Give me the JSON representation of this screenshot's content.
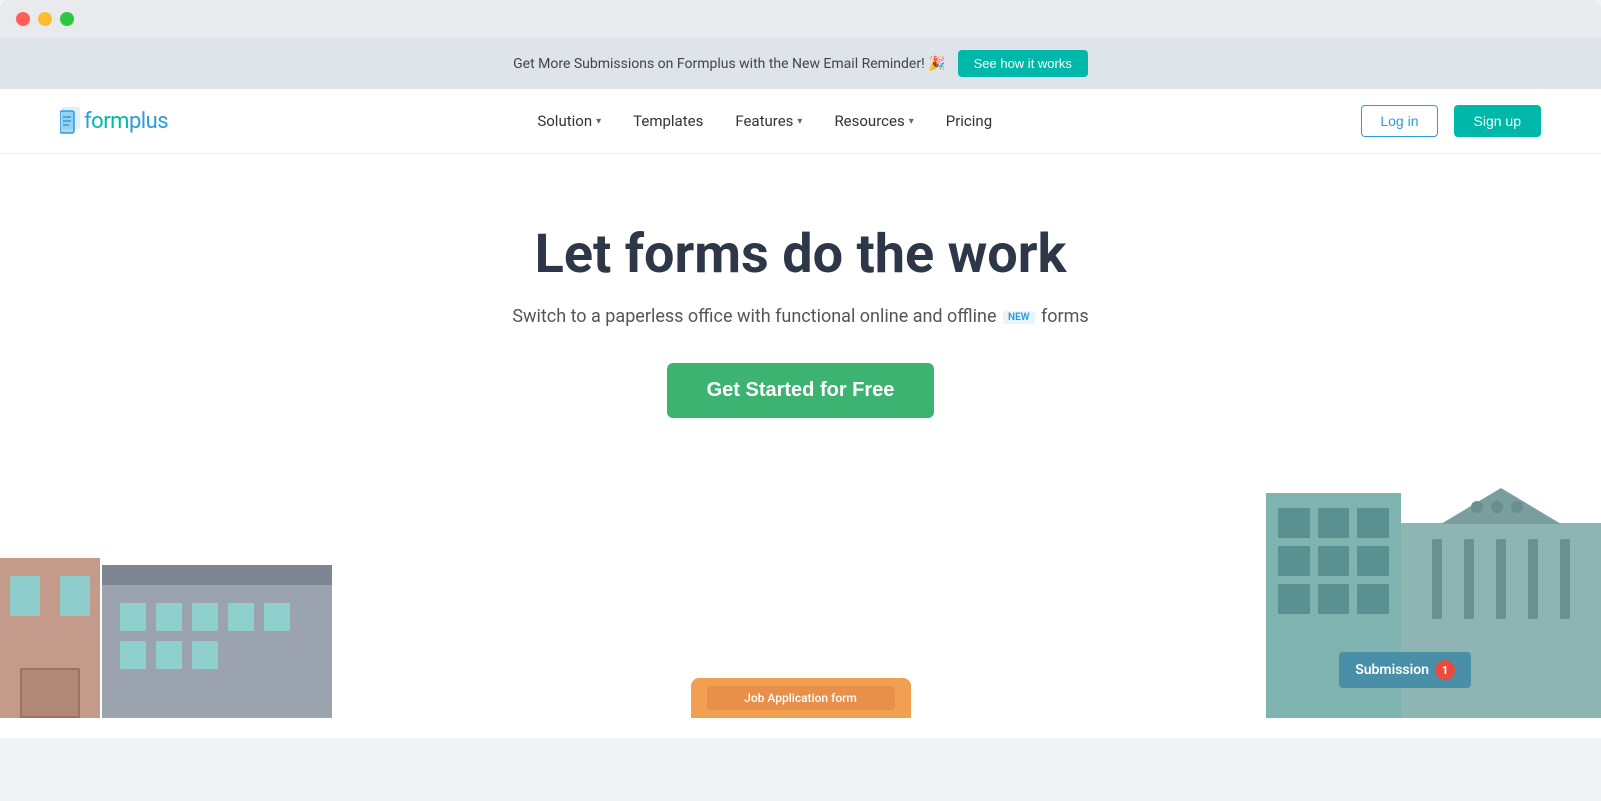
{
  "browser": {
    "dots": [
      "red",
      "yellow",
      "green"
    ]
  },
  "announcement": {
    "text": "Get More Submissions on Formplus with the New Email Reminder! 🎉",
    "cta": "See how it works"
  },
  "nav": {
    "logo_text": "formplus",
    "links": [
      {
        "label": "Solution",
        "has_dropdown": true
      },
      {
        "label": "Templates",
        "has_dropdown": false
      },
      {
        "label": "Features",
        "has_dropdown": true
      },
      {
        "label": "Resources",
        "has_dropdown": true
      },
      {
        "label": "Pricing",
        "has_dropdown": false
      }
    ],
    "login_label": "Log in",
    "signup_label": "Sign up"
  },
  "hero": {
    "title": "Let forms do the work",
    "subtitle_start": "Switch to a paperless office with functional online and offline",
    "subtitle_badge": "NEW",
    "subtitle_end": "forms",
    "cta_label": "Get Started for Free"
  },
  "illustration": {
    "submission_label": "Submission",
    "submission_count": "1",
    "form_card_label": "Job Application form"
  }
}
